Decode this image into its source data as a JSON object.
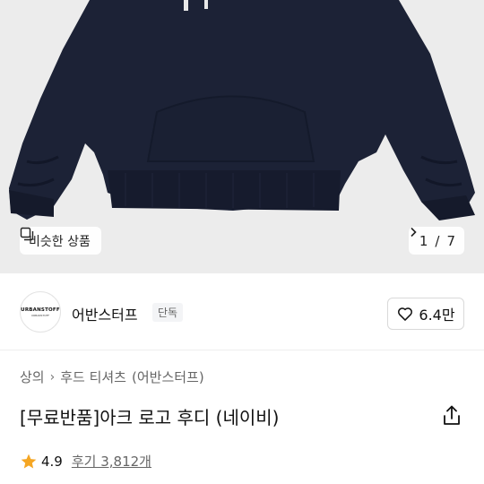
{
  "gallery": {
    "similar_label": "비슷한 상품",
    "current": "1",
    "total": "7",
    "separator": "/"
  },
  "brand": {
    "logo_text": "URBANSTOFF",
    "logo_subtext": "URBANSTOFF",
    "name": "어반스터프",
    "tag": "단독"
  },
  "like": {
    "count": "6.4만"
  },
  "breadcrumb": {
    "items": [
      "상의",
      "후드 티셔츠",
      "(어반스터프)"
    ]
  },
  "product": {
    "title": "[무료반품]아크 로고 후디 (네이비)"
  },
  "rating": {
    "score": "4.9",
    "reviews_label": "후기 3,812개"
  },
  "colors": {
    "navy": "#1c2236",
    "star": "#f5a623"
  }
}
